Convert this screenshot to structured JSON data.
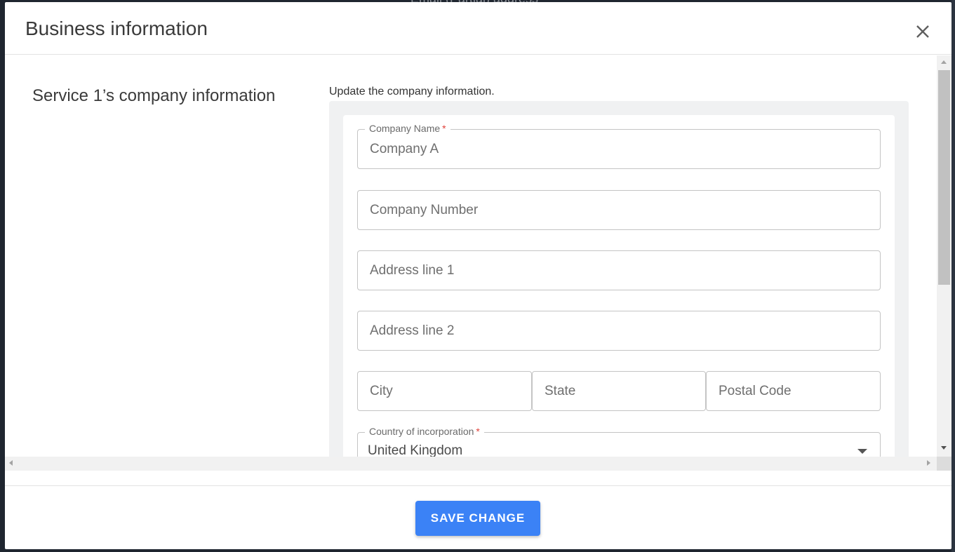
{
  "backdrop": {
    "partial_text": "Email (Partial) address"
  },
  "modal": {
    "title": "Business information",
    "close_icon": "close-icon",
    "section_title": "Service 1’s company information",
    "section_description": "Update the company information.",
    "fields": {
      "company_name": {
        "label": "Company Name",
        "required_mark": "*",
        "value": "Company A"
      },
      "company_number": {
        "placeholder": "Company Number"
      },
      "address_line_1": {
        "placeholder": "Address line 1"
      },
      "address_line_2": {
        "placeholder": "Address line 2"
      },
      "city": {
        "placeholder": "City"
      },
      "state": {
        "placeholder": "State"
      },
      "postal_code": {
        "placeholder": "Postal Code"
      },
      "country": {
        "label": "Country of incorporation",
        "required_mark": "*",
        "value": "United Kingdom"
      }
    },
    "save_button": "SAVE CHANGE"
  },
  "colors": {
    "accent": "#3b82f6",
    "required": "#e0413a",
    "panel_bg": "#f0f1f2"
  }
}
